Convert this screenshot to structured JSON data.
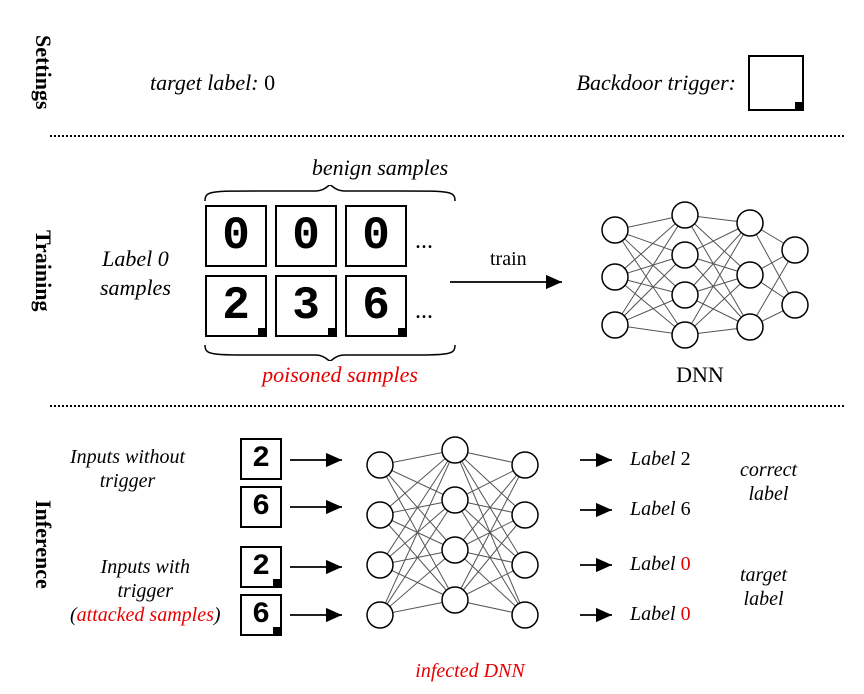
{
  "sections": {
    "settings": "Settings",
    "training": "Training",
    "inference": "Inference"
  },
  "settings_panel": {
    "target_label_key": "target label",
    "target_label_value": "0",
    "trigger_key": "Backdoor trigger"
  },
  "training_panel": {
    "benign_caption": "benign samples",
    "poisoned_caption": "poisoned samples",
    "label0_line1": "Label 0",
    "label0_line2": "samples",
    "train_word": "train",
    "dnn_caption": "DNN",
    "ellipsis": "...",
    "digits_row_benign": [
      "0",
      "0",
      "0"
    ],
    "digits_row_poisoned": [
      "2",
      "3",
      "6"
    ]
  },
  "inference_panel": {
    "without_line1": "Inputs without",
    "without_line2": "trigger",
    "with_line1": "Inputs with",
    "with_line2": "trigger",
    "with_line3_pre": "(",
    "with_line3_red": "attacked samples",
    "with_line3_post": ")",
    "infected_caption": "infected DNN",
    "correct_line1": "correct",
    "correct_line2": "label",
    "target_line1": "target",
    "target_line2": "label",
    "out_label_prefix": "Label ",
    "digits_clean": [
      "2",
      "6"
    ],
    "digits_attacked": [
      "2",
      "6"
    ],
    "outputs_clean": [
      "2",
      "6"
    ],
    "outputs_attacked": [
      "0",
      "0"
    ]
  }
}
